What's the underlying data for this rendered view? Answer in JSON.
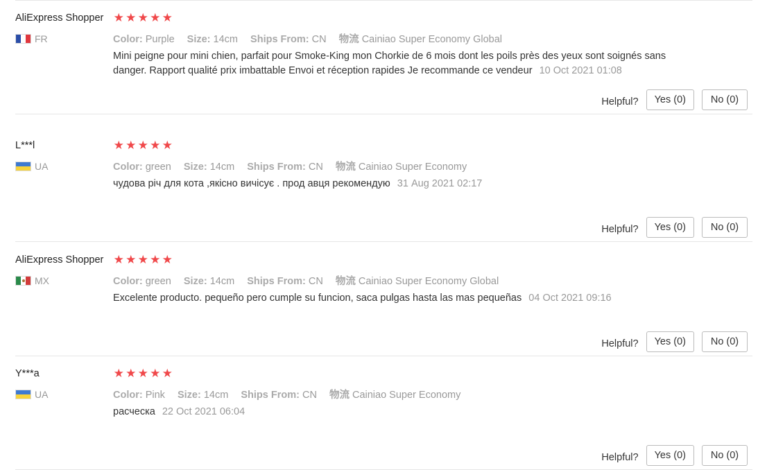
{
  "attr_labels": {
    "color": "Color:",
    "size": "Size:",
    "ships_from": "Ships From:",
    "logistics": "物流"
  },
  "helpful_label": "Helpful?",
  "rating_star_glyph": "★",
  "accent_color": "#f0484a",
  "reviews": [
    {
      "user": "AliExpress Shopper",
      "country": "FR",
      "flag": "flag-fr",
      "rating": 5,
      "color": "Purple",
      "size": "14cm",
      "ships_from": "CN",
      "logistics": "Cainiao Super Economy Global",
      "content": "Mini peigne pour mini chien, parfait pour Smoke-King mon Chorkie de 6 mois dont les poils près des yeux sont soignés sans danger. Rapport qualité prix imbattable Envoi et réception rapides Je recommande ce vendeur",
      "date": "10 Oct 2021 01:08",
      "yes_label": "Yes (0)",
      "no_label": "No (0)"
    },
    {
      "user": "L***l",
      "country": "UA",
      "flag": "flag-ua",
      "rating": 5,
      "color": "green",
      "size": "14cm",
      "ships_from": "CN",
      "logistics": "Cainiao Super Economy",
      "content": "чудова річ для кота ,якісно вичісує . прод авця рекомендую",
      "date": "31 Aug 2021 02:17",
      "yes_label": "Yes (0)",
      "no_label": "No (0)"
    },
    {
      "user": "AliExpress Shopper",
      "country": "MX",
      "flag": "flag-mx",
      "rating": 5,
      "color": "green",
      "size": "14cm",
      "ships_from": "CN",
      "logistics": "Cainiao Super Economy Global",
      "content": "Excelente producto. pequeño pero cumple su funcion, saca pulgas hasta las mas pequeñas",
      "date": "04 Oct 2021 09:16",
      "yes_label": "Yes (0)",
      "no_label": "No (0)"
    },
    {
      "user": "Y***a",
      "country": "UA",
      "flag": "flag-ua",
      "rating": 5,
      "color": "Pink",
      "size": "14cm",
      "ships_from": "CN",
      "logistics": "Cainiao Super Economy",
      "content": "расческа",
      "date": "22 Oct 2021 06:04",
      "yes_label": "Yes (0)",
      "no_label": "No (0)"
    }
  ]
}
